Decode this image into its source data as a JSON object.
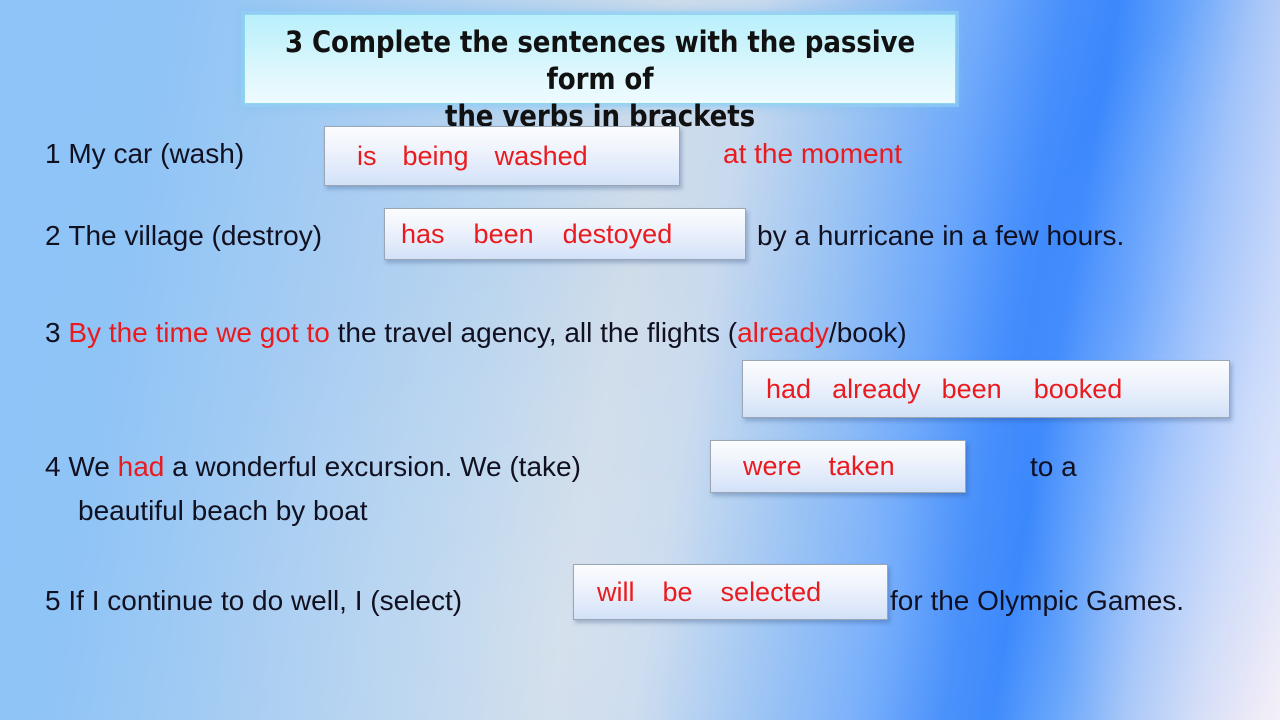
{
  "slide": {
    "title": "3 Complete the sentences with the passive form of\nthe verbs in brackets",
    "colors": {
      "answer_red": "#ea1b1e",
      "text_black": "#101020",
      "title_box_fill": "#cdf4fc",
      "answer_box_fill": "#eef3fc",
      "background_blue": "#8ec5f8"
    }
  },
  "exercises": [
    {
      "number": "1",
      "prompt": "My car (wash)",
      "answer_words": [
        "is",
        "being",
        "washed"
      ],
      "tail": "at the moment",
      "tail_color": "red"
    },
    {
      "number": "2",
      "prompt": "The village (destroy)",
      "answer_words": [
        "has",
        "been",
        "destoyed"
      ],
      "tail": "by a hurricane in a few hours.",
      "tail_color": "black"
    },
    {
      "number": "3",
      "prompt_red": "By the time we got to",
      "prompt_mid": " the travel agency, all the flights (",
      "prompt_red2": "already",
      "prompt_end": "/book)",
      "answer_words": [
        "had",
        "already",
        "been",
        "booked"
      ]
    },
    {
      "number": "4",
      "prompt_a": "We ",
      "prompt_red": "had",
      "prompt_b": " a wonderful excursion. We (take)",
      "answer_words": [
        "were",
        "taken"
      ],
      "tail": "to a",
      "tail_line2": "beautiful  beach by boat"
    },
    {
      "number": "5",
      "prompt": "If I continue to do well, I (select)",
      "answer_words": [
        "will",
        "be",
        "selected"
      ],
      "tail": "for the Olympic Games.",
      "tail_color": "black"
    }
  ]
}
